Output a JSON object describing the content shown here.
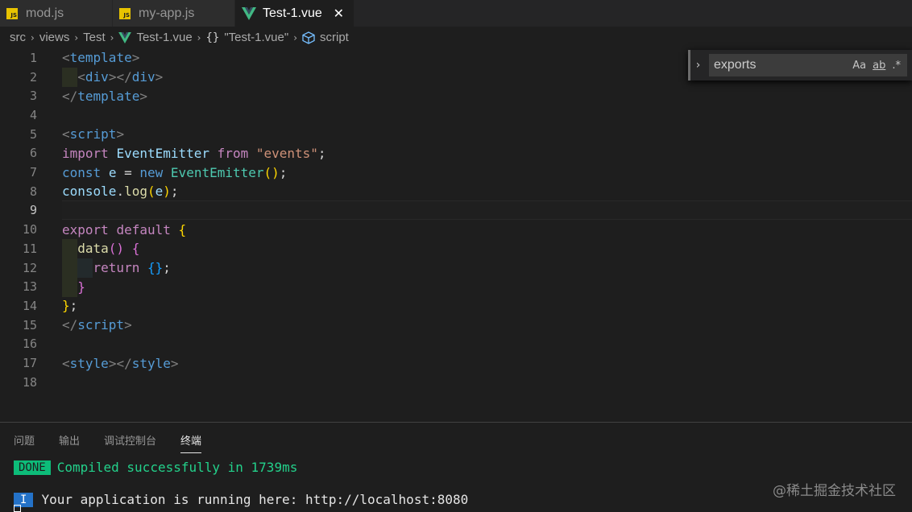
{
  "tabs": [
    {
      "label": "mod.js",
      "icon": "js-icon"
    },
    {
      "label": "my-app.js",
      "icon": "js-icon"
    },
    {
      "label": "Test-1.vue",
      "icon": "vue-icon",
      "active": true
    }
  ],
  "tab_close": "✕",
  "breadcrumb": {
    "src": "src",
    "views": "views",
    "test": "Test",
    "file": "Test-1.vue",
    "braces": "{}",
    "object": "\"Test-1.vue\"",
    "symbol": "script"
  },
  "find": {
    "toggle": "›",
    "value": "exports",
    "match_case": "Aa",
    "whole_word": "ab",
    "regex": ".*"
  },
  "editor": {
    "line_numbers": [
      "1",
      "2",
      "3",
      "4",
      "5",
      "6",
      "7",
      "8",
      "9",
      "10",
      "11",
      "12",
      "13",
      "14",
      "15",
      "16",
      "17",
      "18"
    ],
    "current_line": "9",
    "colors": {
      "tag": "#569cd6",
      "keyword": "#c586c0",
      "string": "#ce9178",
      "class": "#4ec9b0"
    }
  },
  "panel": {
    "tabs": [
      "问题",
      "输出",
      "调试控制台",
      "终端"
    ],
    "active_tab": "终端",
    "done_badge": "DONE",
    "compiled_text": "Compiled successfully in 1739ms",
    "info_badge": "I",
    "running_text": "Your application is running here: http://localhost:8080"
  },
  "watermark": "@稀土掘金技术社区"
}
